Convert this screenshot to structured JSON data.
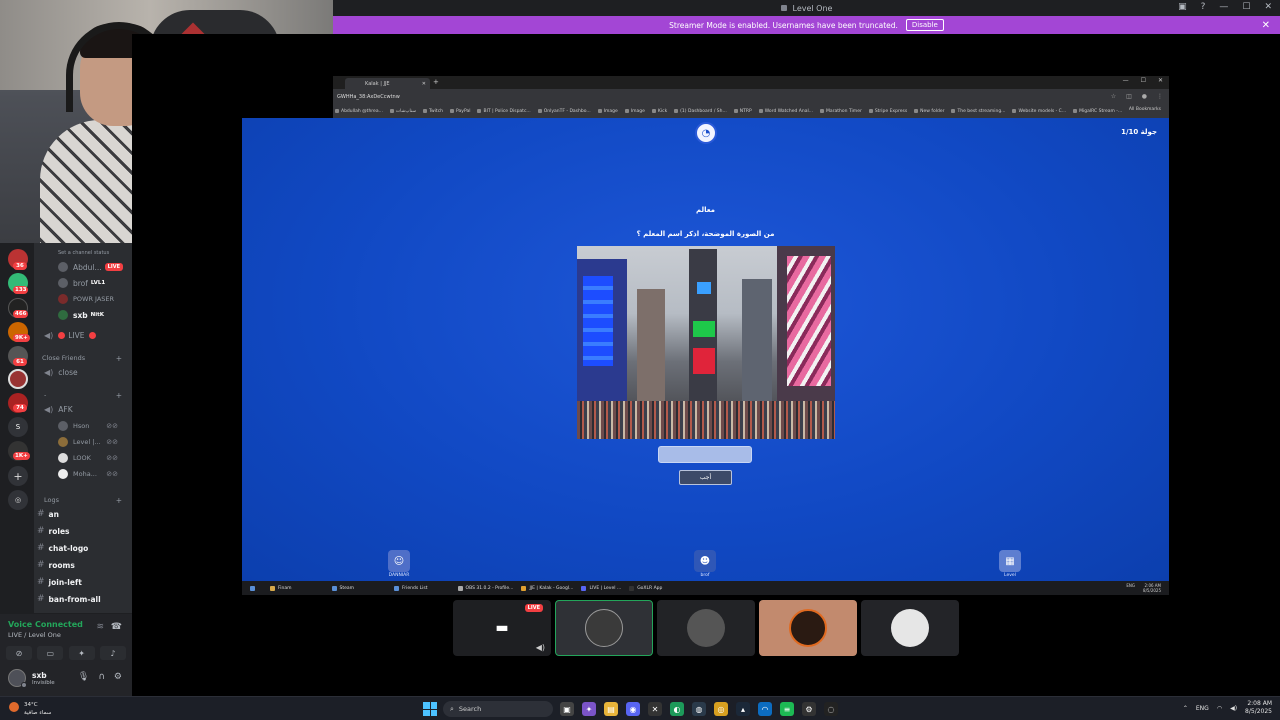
{
  "discord": {
    "window_title": "Level One",
    "streamer_banner": "Streamer Mode is enabled. Usernames have been truncated.",
    "disable_label": "Disable",
    "server_badges": [
      "36",
      "133",
      "466",
      "9K+",
      "61",
      "",
      "74",
      "1K+"
    ],
    "server_letter": "S",
    "channel_status_hint": "Set a channel status",
    "voice_members": [
      {
        "name": "Abdul...",
        "tag": "LIVE"
      },
      {
        "name": "brof",
        "tag": "LVL1"
      },
      {
        "name": "POWR JASER",
        "tag": ""
      },
      {
        "name": "sxb",
        "tag": "NitK"
      }
    ],
    "live_channel": "LIVE",
    "category_close_friends": "Close Friends",
    "channel_close": "close",
    "category_dash": "-",
    "channel_afk": "AFK",
    "afk_members": [
      "Hson",
      "Level |...",
      "LOOK",
      "Moha..."
    ],
    "category_logs": "Logs",
    "text_channels": [
      "an",
      "roles",
      "chat-logo",
      "rooms",
      "join-left",
      "ban-from-all"
    ],
    "voice_connected": "Voice Connected",
    "voice_location": "LIVE / Level One",
    "user_name": "sxb",
    "user_status": "Invisible"
  },
  "browser": {
    "tab_title": "Kalak | JJE",
    "url": "GWHHa_38:AxDeCcwtnw",
    "bookmarks": [
      "Abdullah @threa...",
      "سناپ‌شات",
      "Twitch",
      "PayPal",
      "BIT | Police Dispatc...",
      "OnlyanTF - Dashbo...",
      "Image",
      "Image",
      "Kick",
      "(1) Dashboard / Sh...",
      "NTRP",
      "Word Watched Anal...",
      "Marathon Timer",
      "Stripe Express",
      "New folder",
      "The best streaming...",
      "Website models - C...",
      "MigalRC Stream -..."
    ],
    "all_bookmarks": "All Bookmarks"
  },
  "game": {
    "round_counter": "جولة 1/10",
    "category": "معالم",
    "question": "من الصورة الموضحة، اذكر اسم المعلم ؟",
    "submit_label": "أجب",
    "players": [
      "DANNIAR",
      "brof",
      "Level"
    ]
  },
  "inner_taskbar": {
    "tasks": [
      "Finam",
      "Steam",
      "Friends List",
      "OBS 31.0.2 - Profile...",
      "JJE | Kalak - Googl...",
      "LIVE | Level ...",
      "GoXLR App"
    ],
    "lang": "ENG",
    "time": "2:06 AM",
    "date": "8/5/2025"
  },
  "stream_tiles": {
    "live_label": "LIVE"
  },
  "taskbar": {
    "temperature": "34°C",
    "weather_text": "سماء صافية",
    "search_placeholder": "Search",
    "lang": "ENG",
    "time": "2:08 AM",
    "date": "8/5/2025"
  }
}
